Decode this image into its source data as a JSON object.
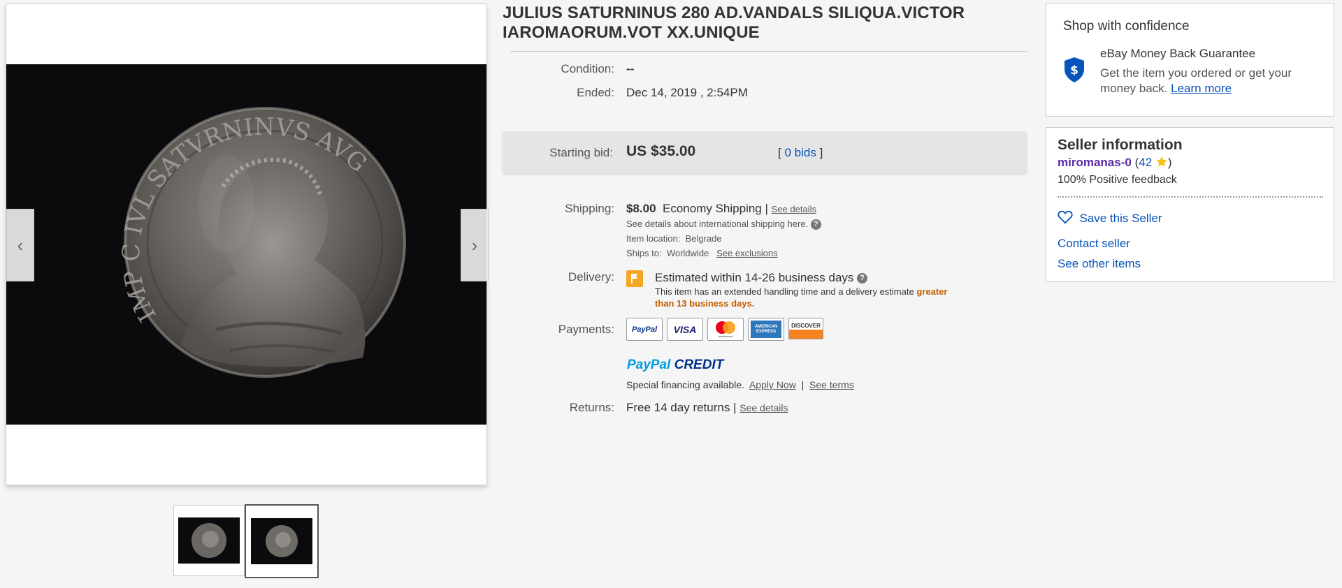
{
  "gallery": {
    "coin_obverse_text": "IMP C IVL SATVRNINVS AVG",
    "prev_arrow": "‹",
    "next_arrow": "›"
  },
  "listing": {
    "title": "JULIUS SATURNINUS 280 AD.VANDALS SILIQUA.VICTOR IAROMAORUM.VOT XX.UNIQUE",
    "condition_label": "Condition:",
    "condition_value": "--",
    "ended_label": "Ended:",
    "ended_value": "Dec 14, 2019 , 2:54PM",
    "starting_bid_label": "Starting bid:",
    "starting_bid_value": "US $35.00",
    "bids_open": "[",
    "bids_link": "0 bids",
    "bids_close": "]",
    "shipping_label": "Shipping:",
    "shipping_price": "$8.00",
    "shipping_method": "Economy Shipping |",
    "shipping_details_link": "See details",
    "intl_shipping_note": "See details about international shipping here.",
    "item_location_label": "Item location:",
    "item_location_value": "Belgrade",
    "ships_to_label": "Ships to:",
    "ships_to_value": "Worldwide",
    "see_exclusions_link": "See exclusions",
    "delivery_label": "Delivery:",
    "delivery_estimate": "Estimated within 14-26 business days",
    "delivery_note": "This item has an extended handling time and a delivery estimate",
    "delivery_note_highlight_1": "greater",
    "delivery_note_highlight_2": "than 13 business days.",
    "payments_label": "Payments:",
    "payment_methods": [
      "PayPal",
      "VISA",
      "mastercard",
      "AMERICAN EXPRESS",
      "DISCOVER"
    ],
    "paypal_credit_1": "PayPal",
    "paypal_credit_2": "CREDIT",
    "financing_text": "Special financing available.",
    "apply_now_link": "Apply Now",
    "separator": "|",
    "see_terms_link": "See terms",
    "returns_label": "Returns:",
    "returns_value": "Free 14 day returns |",
    "returns_details_link": "See details",
    "help_mark": "?"
  },
  "confidence": {
    "heading": "Shop with confidence",
    "guarantee_title": "eBay Money Back Guarantee",
    "guarantee_text": "Get the item you ordered or get your",
    "guarantee_text_2": "money back.",
    "learn_more_link": "Learn more",
    "shield_symbol": "$"
  },
  "seller": {
    "heading": "Seller information",
    "name": "miromanas-0",
    "open_paren": "(",
    "score": "42",
    "close_paren": ")",
    "feedback": "100% Positive feedback",
    "save_seller": "Save this Seller",
    "contact_seller": "Contact seller",
    "see_other_items": "See other items"
  },
  "colors": {
    "link": "#0654ba",
    "seller_name": "#5b27a8",
    "delivery_flag": "#f5a623",
    "highlight": "#c45c00"
  }
}
